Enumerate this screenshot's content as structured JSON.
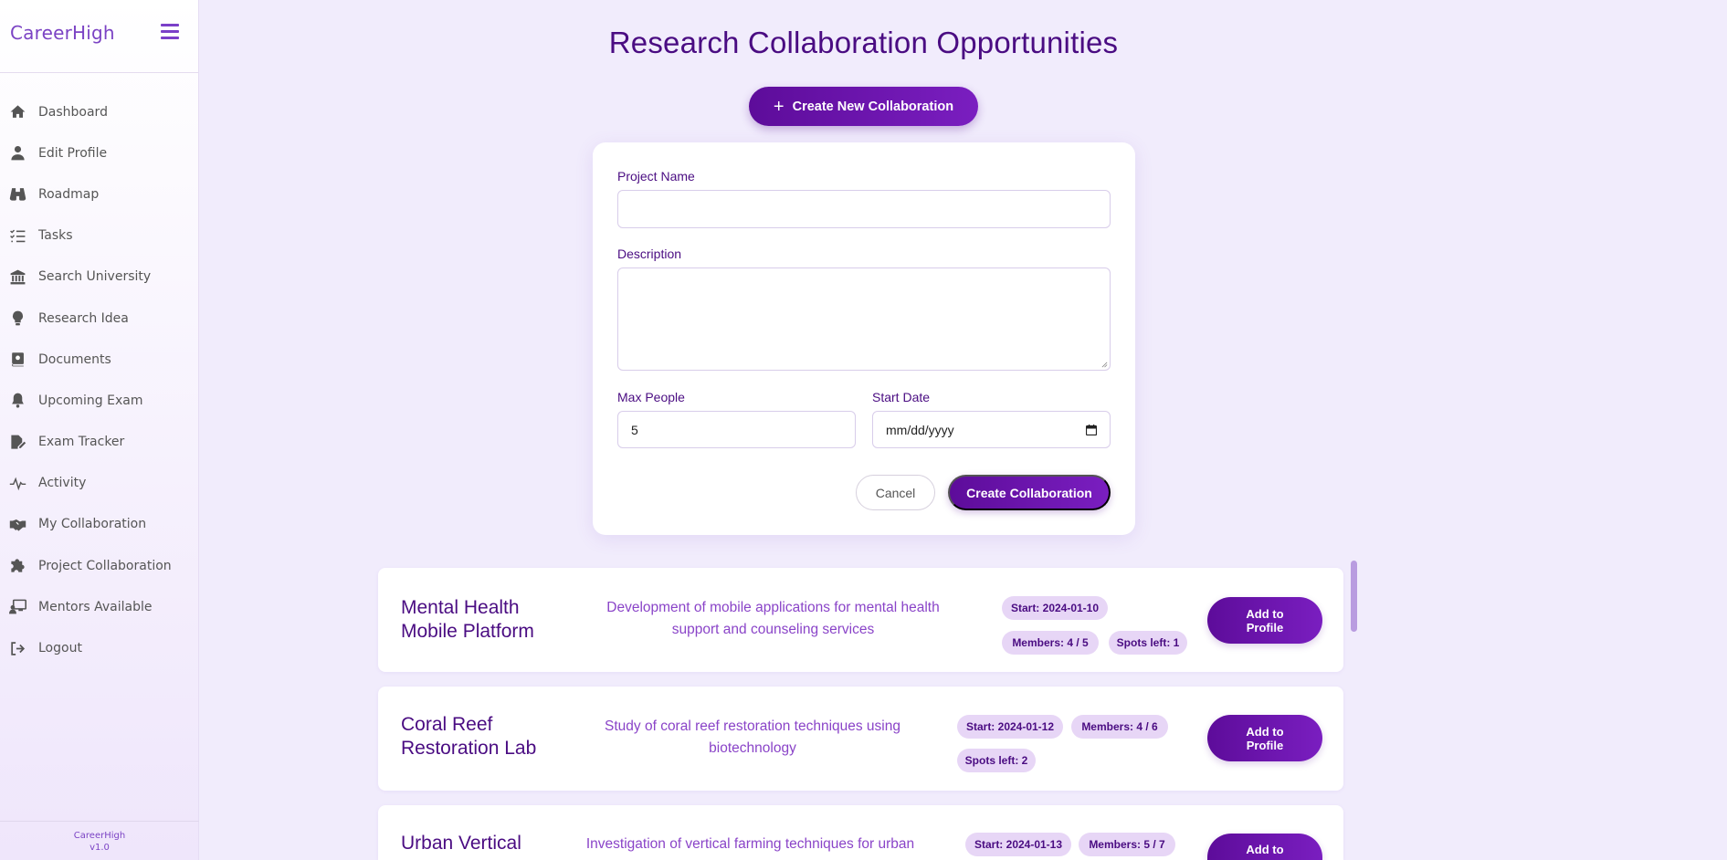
{
  "sidebar": {
    "brand": "CareerHigh",
    "items": [
      {
        "label": "Dashboard",
        "icon": "home-icon"
      },
      {
        "label": "Edit Profile",
        "icon": "user-icon"
      },
      {
        "label": "Roadmap",
        "icon": "binoculars-icon"
      },
      {
        "label": "Tasks",
        "icon": "list-check-icon"
      },
      {
        "label": "Search University",
        "icon": "university-icon"
      },
      {
        "label": "Research Idea",
        "icon": "lightbulb-icon"
      },
      {
        "label": "Documents",
        "icon": "book-icon"
      },
      {
        "label": "Upcoming Exam",
        "icon": "bell-icon"
      },
      {
        "label": "Exam Tracker",
        "icon": "file-signature-icon"
      },
      {
        "label": "Activity",
        "icon": "pulse-icon"
      },
      {
        "label": "My Collaboration",
        "icon": "handshake-icon"
      },
      {
        "label": "Project Collaboration",
        "icon": "puzzle-icon"
      },
      {
        "label": "Mentors Available",
        "icon": "chalkboard-user-icon"
      },
      {
        "label": "Logout",
        "icon": "sign-out-icon"
      }
    ],
    "footer_name": "CareerHigh",
    "footer_version": "v1.0"
  },
  "page": {
    "title": "Research Collaboration Opportunities",
    "create_button": "Create New Collaboration"
  },
  "form": {
    "project_name_label": "Project Name",
    "project_name_value": "",
    "description_label": "Description",
    "description_value": "",
    "max_people_label": "Max People",
    "max_people_value": "5",
    "start_date_label": "Start Date",
    "start_date_placeholder": "mm/dd/yyyy",
    "cancel_label": "Cancel",
    "submit_label": "Create Collaboration"
  },
  "collaborations": [
    {
      "title_line1": "Mental Health",
      "title_line2": "Mobile Platform",
      "desc_line1": "Development of mobile applications for mental health",
      "desc_line2": "support and counseling services",
      "start": "Start: 2024-01-10",
      "members": "Members: 4 / 5",
      "spots": "Spots left: 1",
      "button_line1": "Add to",
      "button_line2": "Profile"
    },
    {
      "title_line1": "Coral Reef",
      "title_line2": "Restoration Lab",
      "desc_line1": "Study of coral reef restoration techniques using",
      "desc_line2": "biotechnology",
      "start": "Start: 2024-01-12",
      "members": "Members: 4 / 6",
      "spots": "Spots left: 2",
      "button_line1": "Add to",
      "button_line2": "Profile"
    },
    {
      "title_line1": "Urban Vertical",
      "desc_line1": "Investigation of vertical farming techniques for urban",
      "start": "Start: 2024-01-13",
      "members": "Members: 5 / 7",
      "button_line1": "Add to"
    }
  ],
  "colors": {
    "accent": "#5d0c9a",
    "title": "#4a0c82",
    "description": "#8a44c8",
    "pill_bg": "#e7d6f6",
    "page_bg": "#f1ecfc"
  }
}
